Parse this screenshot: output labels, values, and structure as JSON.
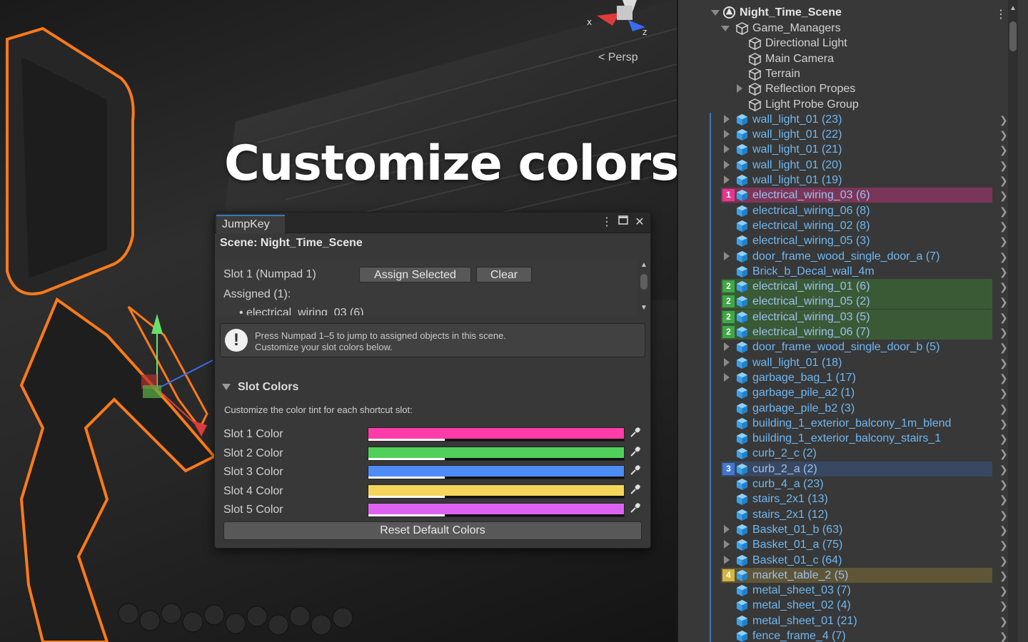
{
  "headline": "Customize colors",
  "viewport": {
    "persp_label": "< Persp",
    "gizmo_x": "x",
    "gizmo_z": "z"
  },
  "jumpkey": {
    "tab_title": "JumpKey",
    "scene_label": "Scene: Night_Time_Scene",
    "slot_label": "Slot 1 (Numpad 1)",
    "assign_button": "Assign Selected",
    "clear_button": "Clear",
    "assigned_label": "Assigned (1):",
    "assigned_item": "• electrical_wiring_03 (6)",
    "help_line1": "Press Numpad 1–5 to jump to assigned objects in this scene.",
    "help_line2": "Customize your slot colors below.",
    "slot_colors_title": "Slot Colors",
    "slot_colors_desc": "Customize the color tint for each shortcut slot:",
    "slot_colors": [
      {
        "label": "Slot 1 Color",
        "color": "#ff3ca8"
      },
      {
        "label": "Slot 2 Color",
        "color": "#4fd05a"
      },
      {
        "label": "Slot 3 Color",
        "color": "#4d8cf5"
      },
      {
        "label": "Slot 4 Color",
        "color": "#f4d65a"
      },
      {
        "label": "Slot 5 Color",
        "color": "#de62f2"
      }
    ],
    "reset_button": "Reset Default Colors"
  },
  "hierarchy": {
    "root": "Night_Time_Scene",
    "items": [
      {
        "name": "Game_Managers",
        "indent": 1,
        "arrow": "down",
        "prefab": false
      },
      {
        "name": "Directional Light",
        "indent": 2,
        "arrow": "",
        "prefab": false
      },
      {
        "name": "Main Camera",
        "indent": 2,
        "arrow": "",
        "prefab": false
      },
      {
        "name": "Terrain",
        "indent": 2,
        "arrow": "",
        "prefab": false
      },
      {
        "name": "Reflection Propes",
        "indent": 2,
        "arrow": "right",
        "prefab": false
      },
      {
        "name": "Light Probe Group",
        "indent": 2,
        "arrow": "",
        "prefab": false
      },
      {
        "name": "wall_light_01 (23)",
        "indent": 1,
        "arrow": "right",
        "prefab": true
      },
      {
        "name": "wall_light_01 (22)",
        "indent": 1,
        "arrow": "right",
        "prefab": true
      },
      {
        "name": "wall_light_01 (21)",
        "indent": 1,
        "arrow": "right",
        "prefab": true
      },
      {
        "name": "wall_light_01 (20)",
        "indent": 1,
        "arrow": "right",
        "prefab": true
      },
      {
        "name": "wall_light_01 (19)",
        "indent": 1,
        "arrow": "right",
        "prefab": true
      },
      {
        "name": "electrical_wiring_03 (6)",
        "indent": 1,
        "arrow": "",
        "prefab": true,
        "slot": "1"
      },
      {
        "name": "electrical_wiring_06 (8)",
        "indent": 1,
        "arrow": "",
        "prefab": true
      },
      {
        "name": "electrical_wiring_02 (8)",
        "indent": 1,
        "arrow": "",
        "prefab": true
      },
      {
        "name": "electrical_wiring_05 (3)",
        "indent": 1,
        "arrow": "",
        "prefab": true
      },
      {
        "name": "door_frame_wood_single_door_a (7)",
        "indent": 1,
        "arrow": "right",
        "prefab": true
      },
      {
        "name": "Brick_b_Decal_wall_4m",
        "indent": 1,
        "arrow": "",
        "prefab": true
      },
      {
        "name": "electrical_wiring_01 (6)",
        "indent": 1,
        "arrow": "",
        "prefab": true,
        "slot": "2"
      },
      {
        "name": "electrical_wiring_05 (2)",
        "indent": 1,
        "arrow": "",
        "prefab": true,
        "slot": "2"
      },
      {
        "name": "electrical_wiring_03 (5)",
        "indent": 1,
        "arrow": "",
        "prefab": true,
        "slot": "2"
      },
      {
        "name": "electrical_wiring_06 (7)",
        "indent": 1,
        "arrow": "",
        "prefab": true,
        "slot": "2"
      },
      {
        "name": "door_frame_wood_single_door_b (5)",
        "indent": 1,
        "arrow": "right",
        "prefab": true
      },
      {
        "name": "wall_light_01 (18)",
        "indent": 1,
        "arrow": "right",
        "prefab": true
      },
      {
        "name": "garbage_bag_1 (17)",
        "indent": 1,
        "arrow": "right",
        "prefab": true
      },
      {
        "name": "garbage_pile_a2 (1)",
        "indent": 1,
        "arrow": "",
        "prefab": true
      },
      {
        "name": "garbage_pile_b2 (3)",
        "indent": 1,
        "arrow": "",
        "prefab": true
      },
      {
        "name": "building_1_exterior_balcony_1m_blend",
        "indent": 1,
        "arrow": "",
        "prefab": true
      },
      {
        "name": "building_1_exterior_balcony_stairs_1",
        "indent": 1,
        "arrow": "",
        "prefab": true
      },
      {
        "name": "curb_2_c (2)",
        "indent": 1,
        "arrow": "",
        "prefab": true
      },
      {
        "name": "curb_2_a (2)",
        "indent": 1,
        "arrow": "",
        "prefab": true,
        "slot": "3"
      },
      {
        "name": "curb_4_a (23)",
        "indent": 1,
        "arrow": "",
        "prefab": true
      },
      {
        "name": "stairs_2x1 (13)",
        "indent": 1,
        "arrow": "",
        "prefab": true
      },
      {
        "name": "stairs_2x1 (12)",
        "indent": 1,
        "arrow": "",
        "prefab": true
      },
      {
        "name": "Basket_01_b (63)",
        "indent": 1,
        "arrow": "right",
        "prefab": true
      },
      {
        "name": "Basket_01_a (75)",
        "indent": 1,
        "arrow": "right",
        "prefab": true
      },
      {
        "name": "Basket_01_c (64)",
        "indent": 1,
        "arrow": "right",
        "prefab": true
      },
      {
        "name": "market_table_2 (5)",
        "indent": 1,
        "arrow": "",
        "prefab": true,
        "slot": "4"
      },
      {
        "name": "metal_sheet_03 (7)",
        "indent": 1,
        "arrow": "",
        "prefab": true
      },
      {
        "name": "metal_sheet_02 (4)",
        "indent": 1,
        "arrow": "",
        "prefab": true
      },
      {
        "name": "metal_sheet_01 (21)",
        "indent": 1,
        "arrow": "",
        "prefab": true
      },
      {
        "name": "fence_frame_4 (7)",
        "indent": 1,
        "arrow": "",
        "prefab": true
      }
    ],
    "slot_highlights": {
      "1": {
        "badge": "#e8368f",
        "row": "#7a3658"
      },
      "2": {
        "badge": "#3fa845",
        "row": "#3a5a36"
      },
      "3": {
        "badge": "#3f78d6",
        "row": "#384863"
      },
      "4": {
        "badge": "#d4b640",
        "row": "#5e5636"
      }
    },
    "text_color": "#6fb8f2",
    "plain_text_color": "#d2d2d2",
    "highlight_text_color": "#b8c8e8"
  }
}
